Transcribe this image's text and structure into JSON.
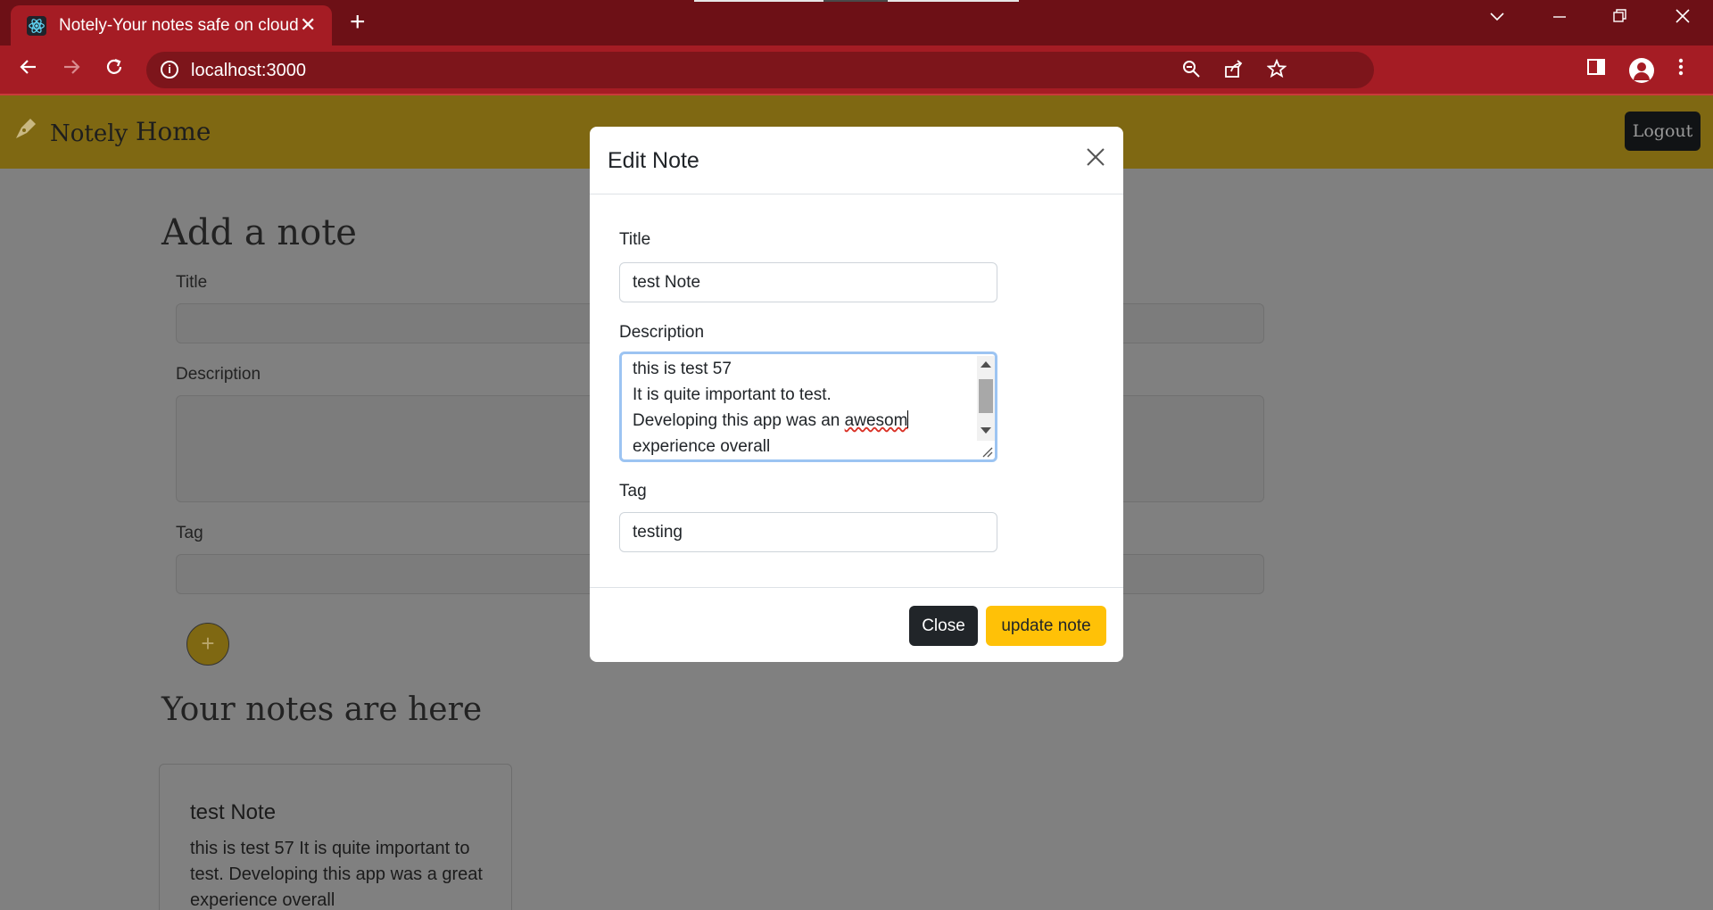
{
  "browser": {
    "tab_title": "Notely-Your notes safe on cloud",
    "tab_close": "✕",
    "new_tab": "+",
    "url": "localhost:3000",
    "theme_color": "#a51c24"
  },
  "navbar": {
    "brand": "Notely",
    "home": "Home",
    "logout": "Logout",
    "color": "#7f6812"
  },
  "add_note": {
    "heading": "Add a note",
    "title_label": "Title",
    "description_label": "Description",
    "tag_label": "Tag",
    "add_icon": "+"
  },
  "notes": {
    "heading": "Your notes are here",
    "items": [
      {
        "title": "test Note",
        "description": "this is test 57 It is quite important to test. Developing this app was a great experience overall"
      }
    ]
  },
  "modal": {
    "title": "Edit Note",
    "title_label": "Title",
    "title_value": "test Note",
    "description_label": "Description",
    "description_lines": [
      "this is test 57",
      "It is quite important to test.",
      "Developing this app was an ",
      "experience overall"
    ],
    "description_misspelled": "awesom",
    "tag_label": "Tag",
    "tag_value": "testing",
    "close_label": "Close",
    "update_label": "update note",
    "accent_color": "#ffc107"
  }
}
